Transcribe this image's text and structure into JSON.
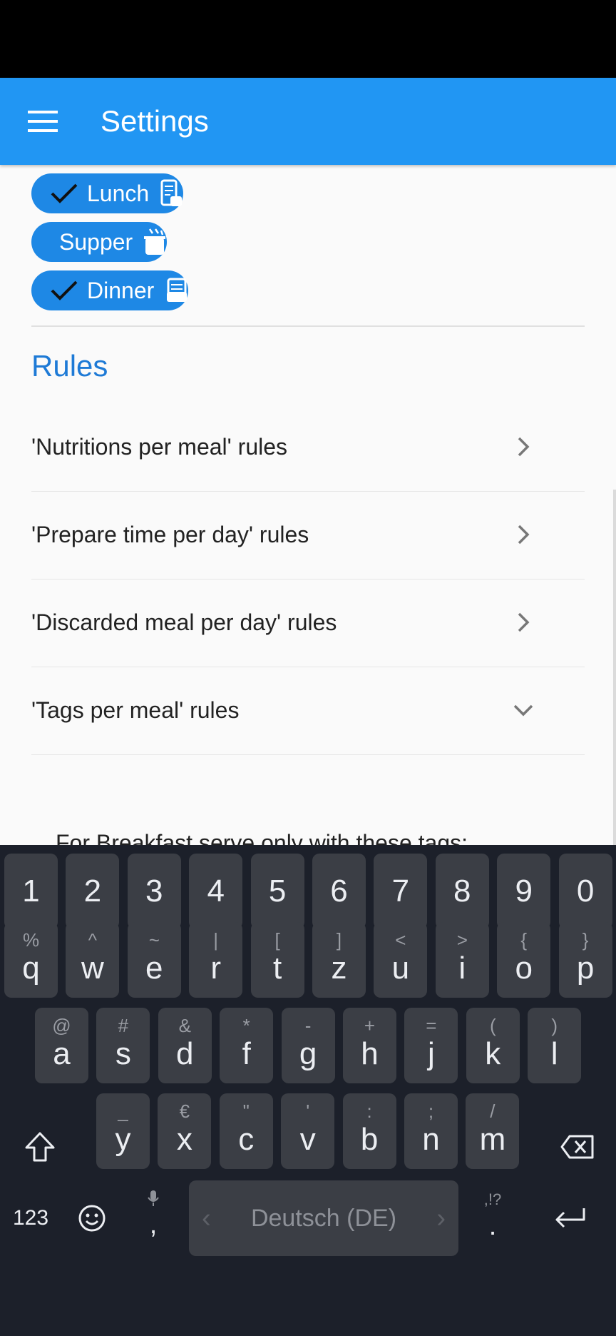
{
  "app_bar": {
    "title": "Settings",
    "menu_icon": "hamburger-menu-icon"
  },
  "meals": [
    {
      "label": "Lunch",
      "selected": true,
      "icon": "lunch-tray-icon"
    },
    {
      "label": "Supper",
      "selected": false,
      "icon": "supper-pot-icon"
    },
    {
      "label": "Dinner",
      "selected": true,
      "icon": "dinner-tray-icon"
    }
  ],
  "rules": {
    "heading": "Rules",
    "items": [
      {
        "label": "'Nutritions per meal' rules",
        "chevron": "chevron-right-icon"
      },
      {
        "label": "'Prepare time per day' rules",
        "chevron": "chevron-right-icon"
      },
      {
        "label": "'Discarded meal per day' rules",
        "chevron": "chevron-right-icon"
      },
      {
        "label": "'Tags per meal' rules",
        "chevron": "chevron-down-icon"
      }
    ],
    "breakfast_tags_label": "For Breakfast serve only with these tags:"
  },
  "keyboard": {
    "number_row": [
      "1",
      "2",
      "3",
      "4",
      "5",
      "6",
      "7",
      "8",
      "9",
      "0"
    ],
    "row1": [
      {
        "main": "q",
        "alt": "%"
      },
      {
        "main": "w",
        "alt": "^"
      },
      {
        "main": "e",
        "alt": "~"
      },
      {
        "main": "r",
        "alt": "|"
      },
      {
        "main": "t",
        "alt": "["
      },
      {
        "main": "z",
        "alt": "]"
      },
      {
        "main": "u",
        "alt": "<"
      },
      {
        "main": "i",
        "alt": ">"
      },
      {
        "main": "o",
        "alt": "{"
      },
      {
        "main": "p",
        "alt": "}"
      }
    ],
    "row2": [
      {
        "main": "a",
        "alt": "@"
      },
      {
        "main": "s",
        "alt": "#"
      },
      {
        "main": "d",
        "alt": "&"
      },
      {
        "main": "f",
        "alt": "*"
      },
      {
        "main": "g",
        "alt": "-"
      },
      {
        "main": "h",
        "alt": "+"
      },
      {
        "main": "j",
        "alt": "="
      },
      {
        "main": "k",
        "alt": "("
      },
      {
        "main": "l",
        "alt": ")"
      }
    ],
    "row3": [
      {
        "main": "y",
        "alt": "_"
      },
      {
        "main": "x",
        "alt": "€"
      },
      {
        "main": "c",
        "alt": "\""
      },
      {
        "main": "v",
        "alt": "'"
      },
      {
        "main": "b",
        "alt": ":"
      },
      {
        "main": "n",
        "alt": ";"
      },
      {
        "main": "m",
        "alt": "/"
      }
    ],
    "symbols_key": "123",
    "comma_key": ",",
    "space_label": "Deutsch (DE)",
    "period_key": ".",
    "period_alt": ",!?"
  }
}
